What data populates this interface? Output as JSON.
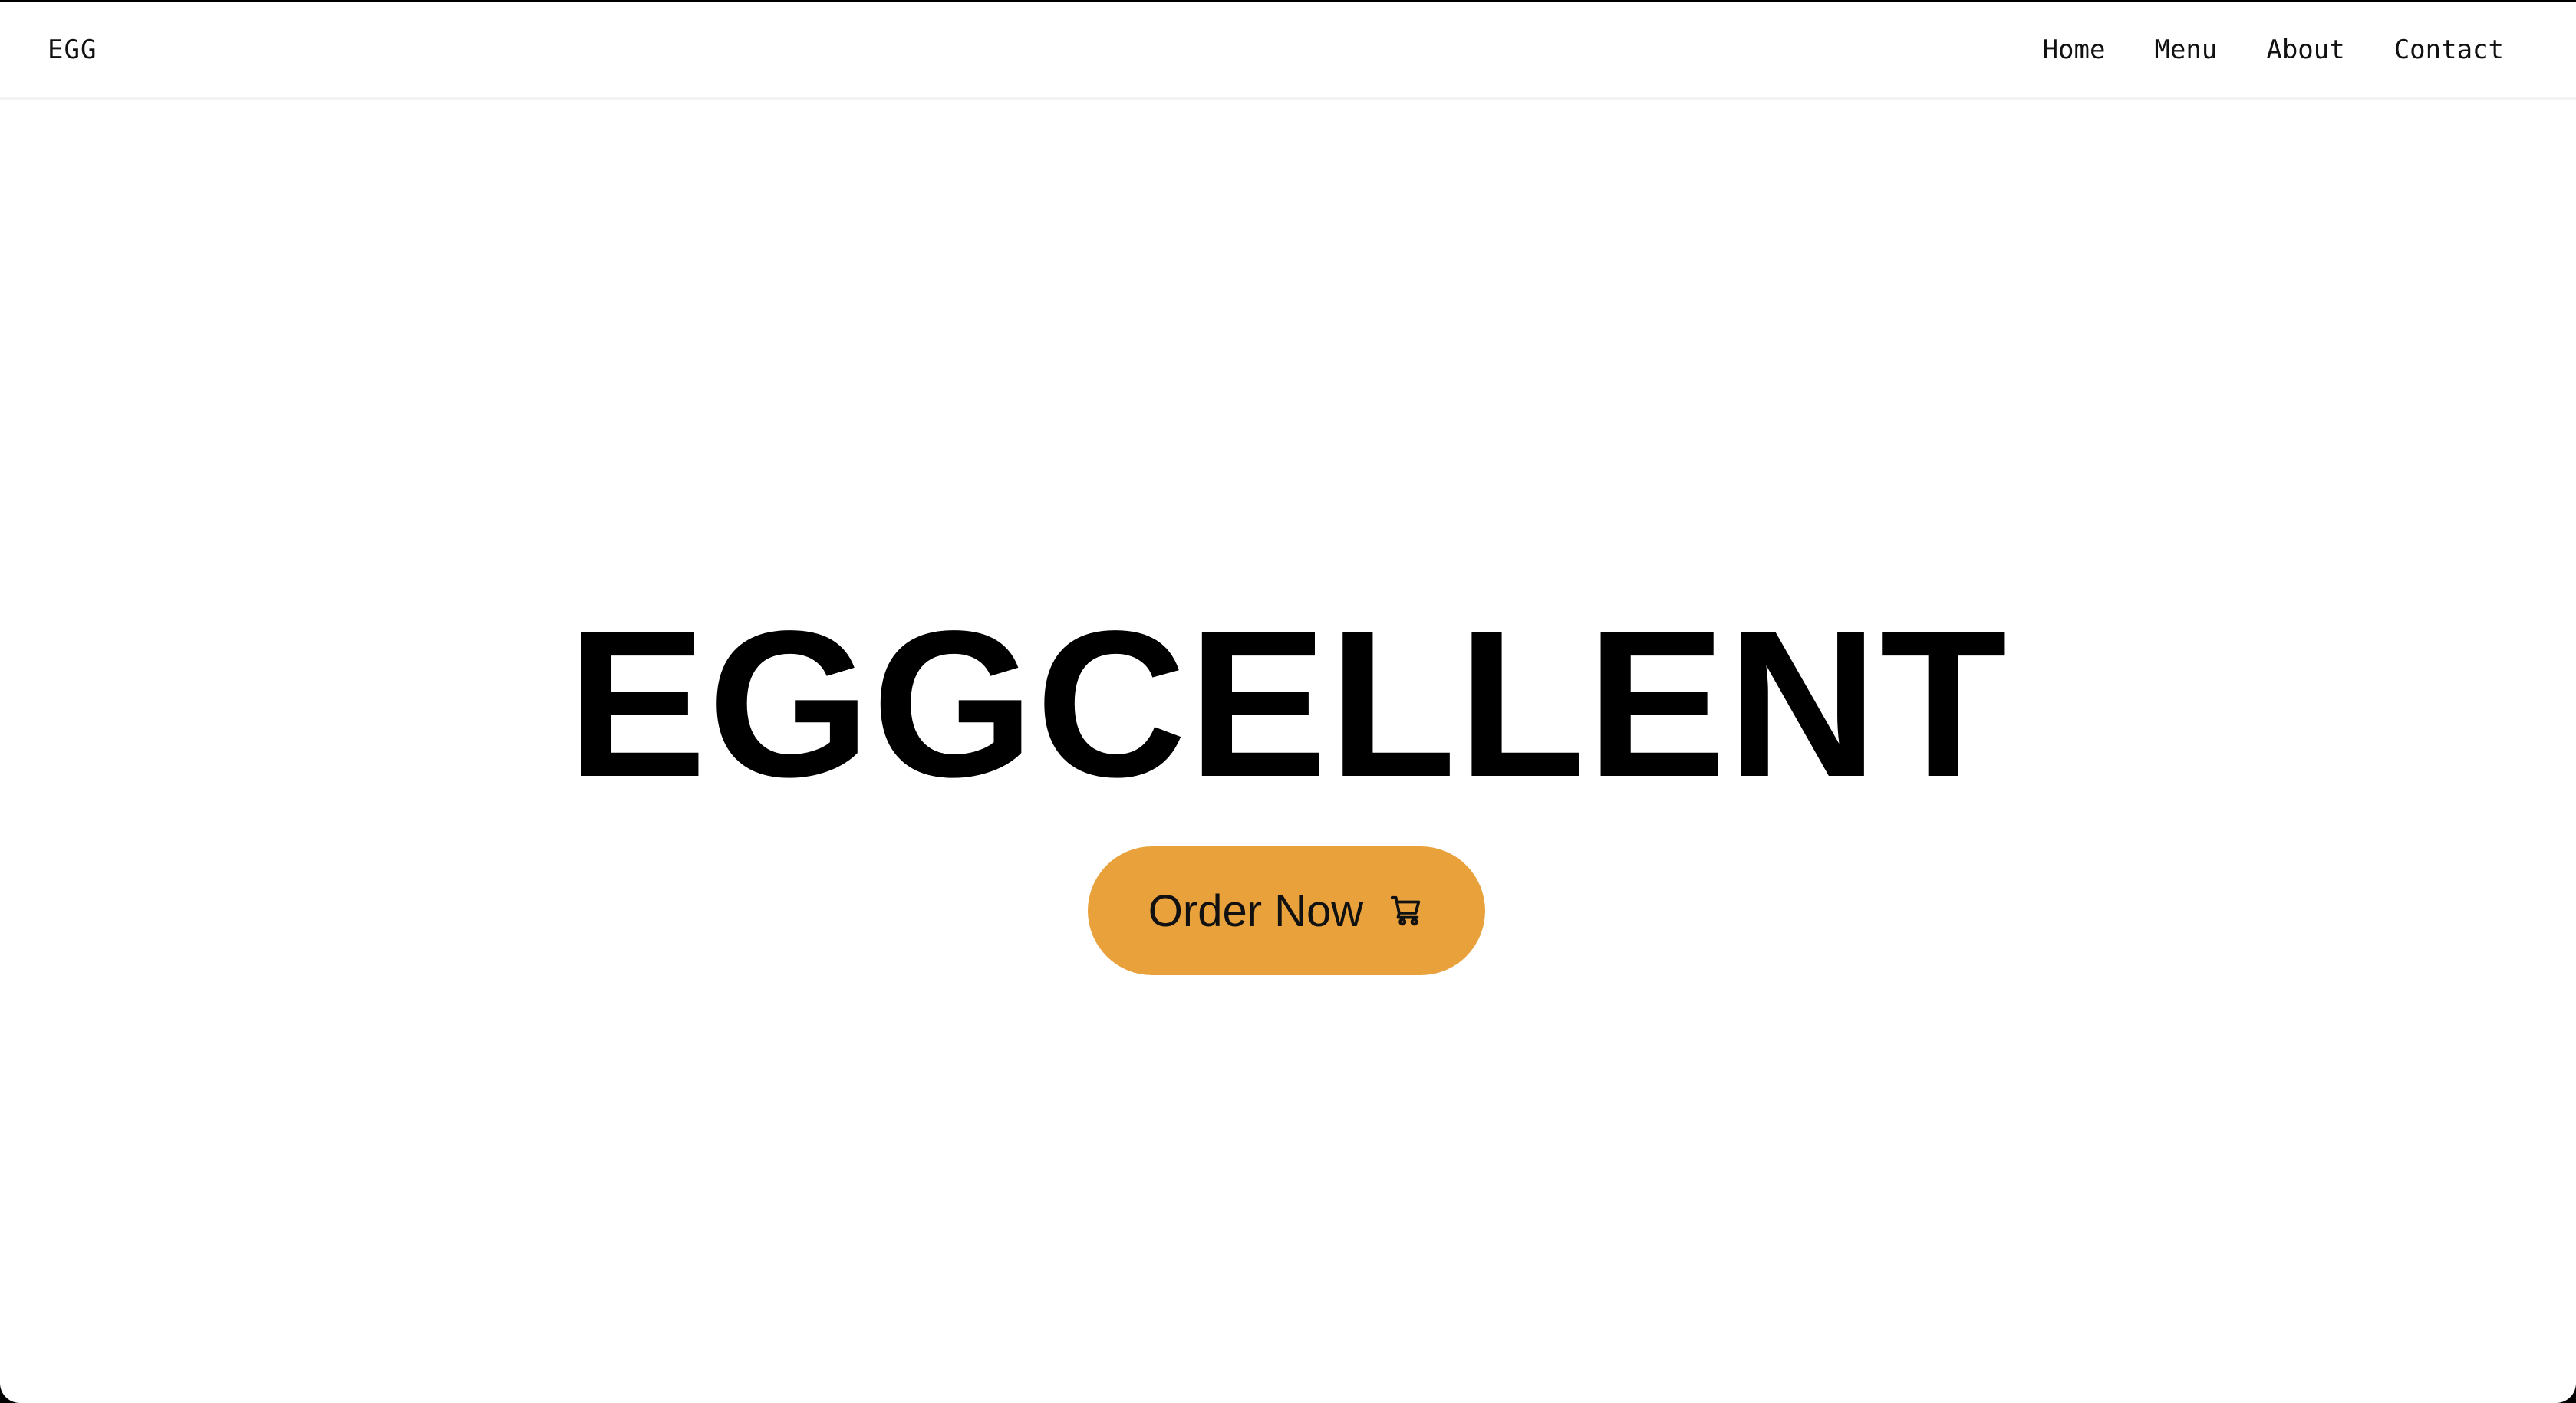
{
  "navbar": {
    "brand": "EGG",
    "links": [
      {
        "label": "Home"
      },
      {
        "label": "Menu"
      },
      {
        "label": "About"
      },
      {
        "label": "Contact"
      }
    ]
  },
  "hero": {
    "title": "EGGCELLENT",
    "cta": {
      "label": "Order Now",
      "icon": "cart-icon"
    }
  },
  "colors": {
    "accent": "#e9a13c",
    "background": "#ffffff",
    "text": "#000000"
  }
}
